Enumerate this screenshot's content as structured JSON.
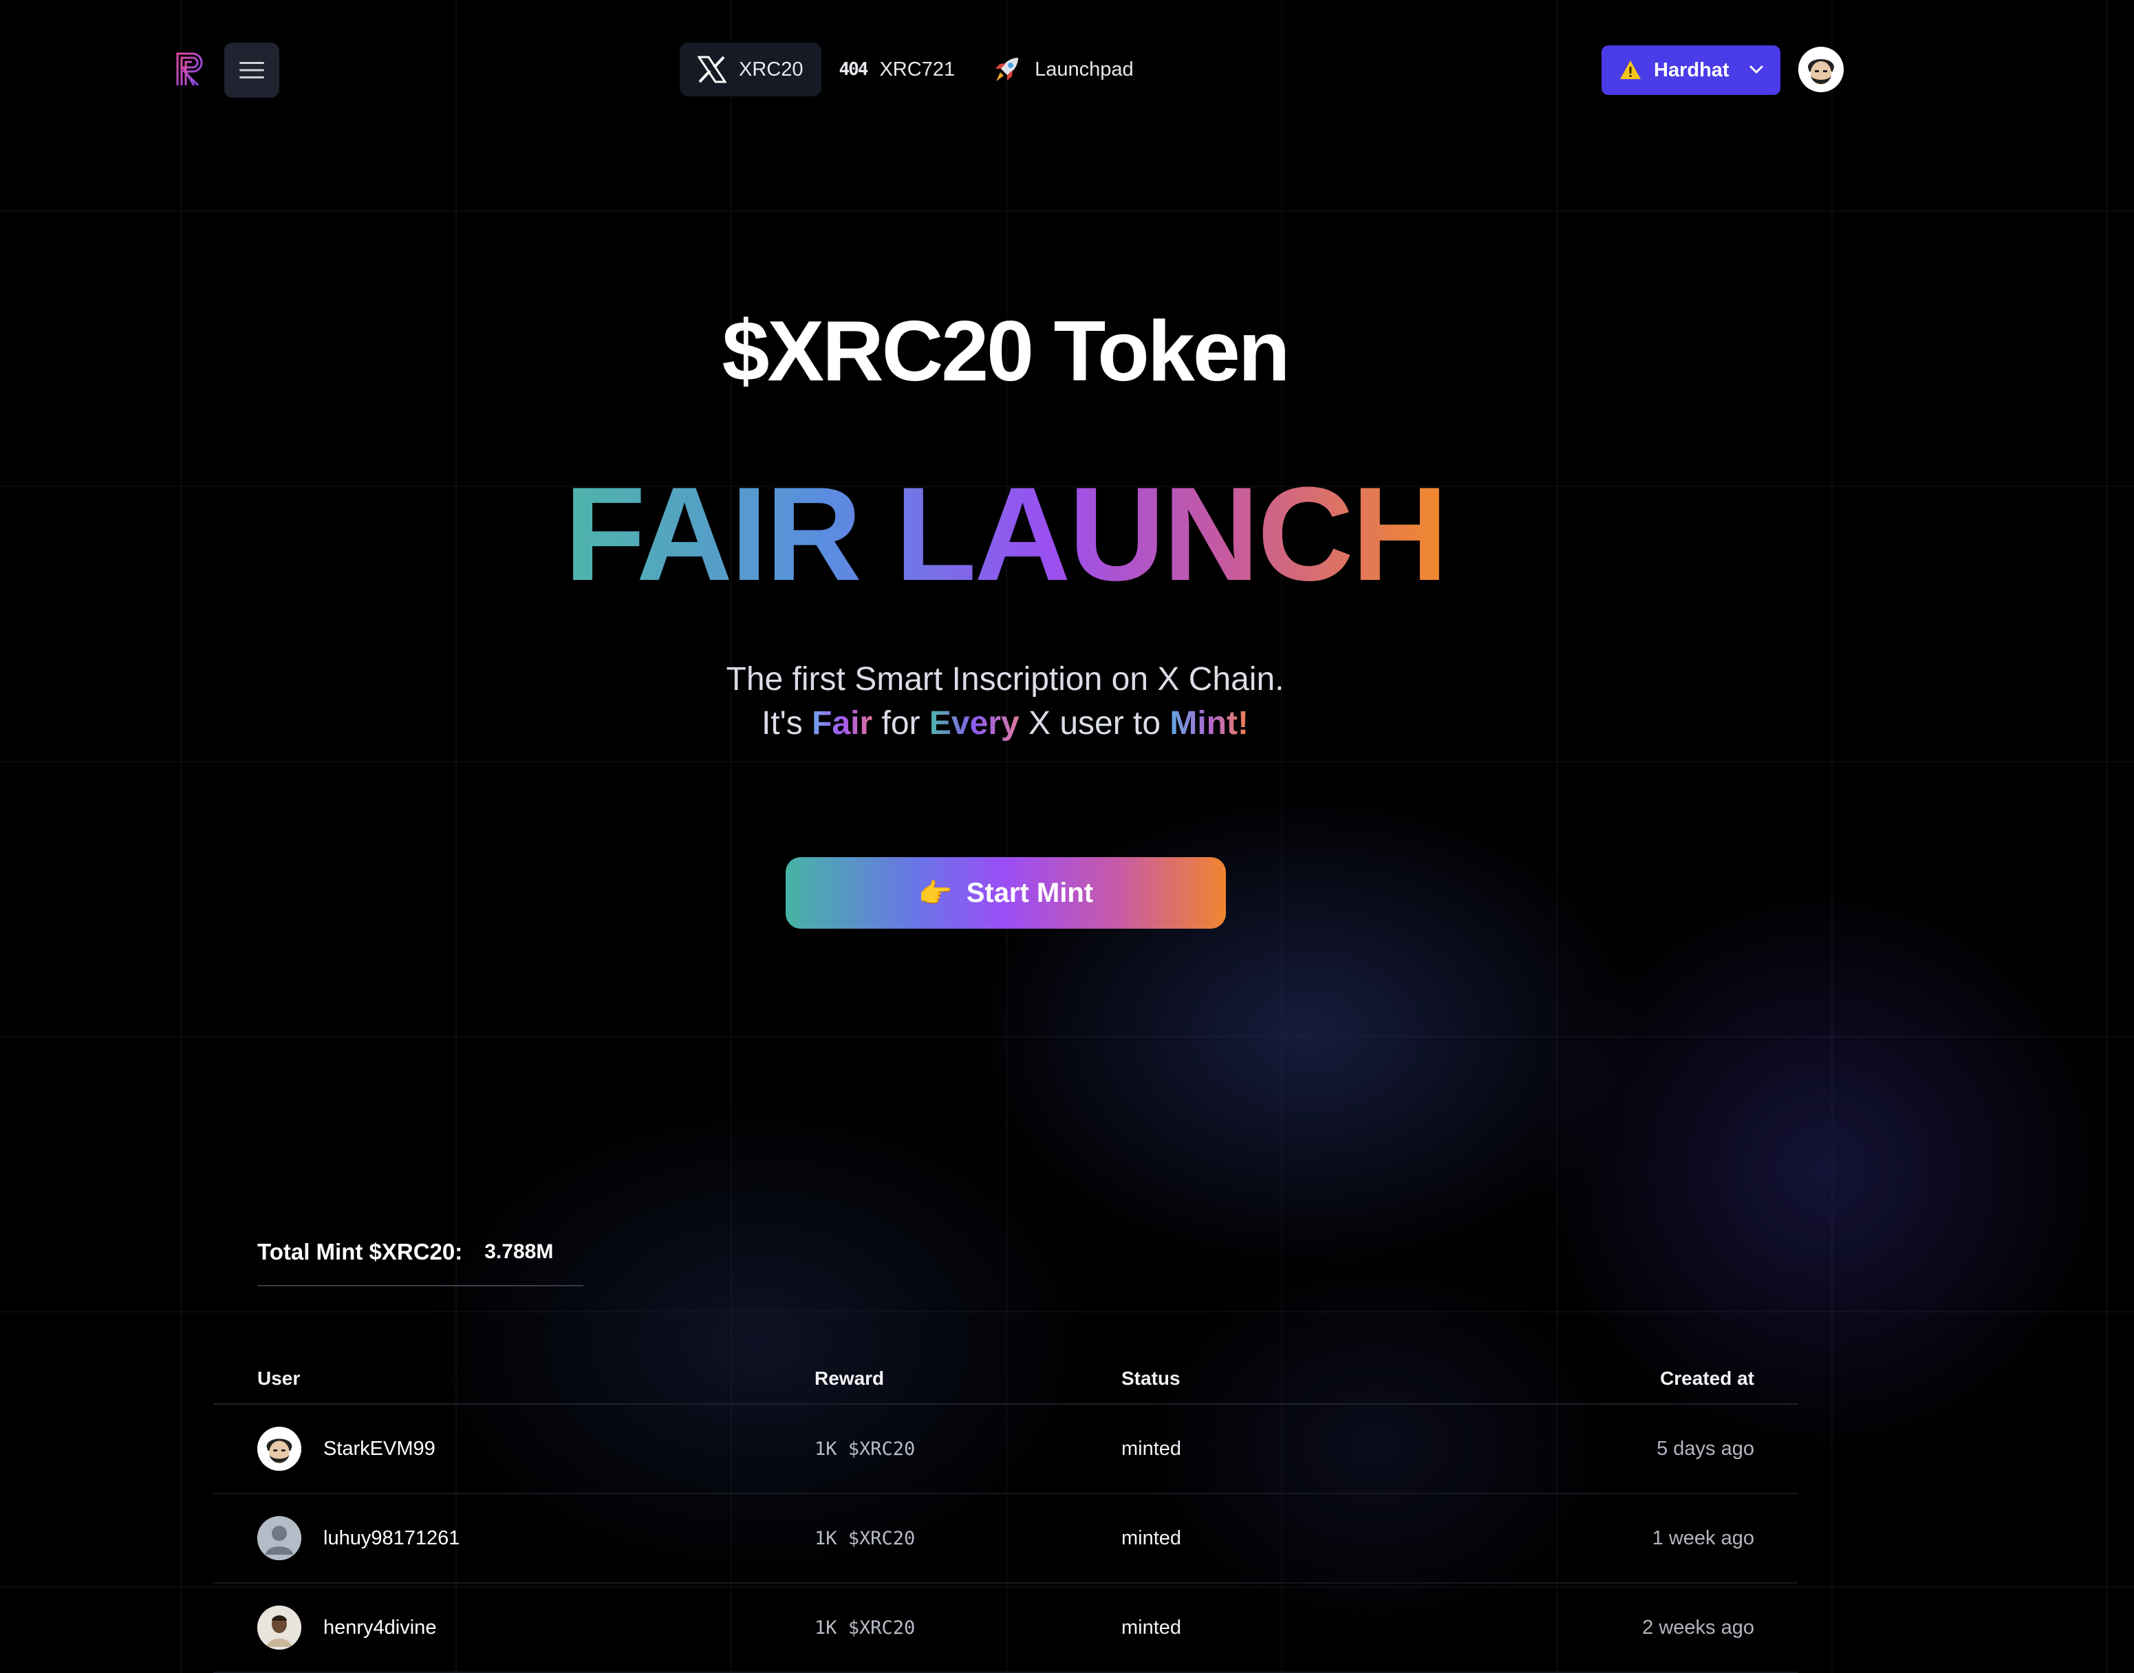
{
  "nav": {
    "tabs": [
      {
        "label": "XRC20",
        "icon": "x-logo-icon",
        "active": true
      },
      {
        "label": "XRC721",
        "icon": "404-icon",
        "active": false
      },
      {
        "label": "Launchpad",
        "icon": "rocket-icon",
        "active": false
      }
    ],
    "network": {
      "label": "Hardhat",
      "icon": "warning-icon"
    },
    "tab_404_icon_text": "404"
  },
  "hero": {
    "title": "$XRC20 Token",
    "headline": "FAIR LAUNCH",
    "subtitle_line1": "The first Smart Inscription on X Chain.",
    "line2": {
      "p1": "It's ",
      "w1": "Fair",
      "p2": " for ",
      "w2": "Every",
      "p3": " X user to ",
      "w3": "Mint!"
    },
    "cta": {
      "emoji": "👉",
      "label": "Start Mint"
    }
  },
  "stats": {
    "label": "Total Mint $XRC20:",
    "value": "3.788M"
  },
  "table": {
    "columns": {
      "user": "User",
      "reward": "Reward",
      "status": "Status",
      "created": "Created at"
    },
    "rows": [
      {
        "user": "StarkEVM99",
        "reward": "1K $XRC20",
        "status": "minted",
        "created": "5 days ago"
      },
      {
        "user": "luhuy98171261",
        "reward": "1K $XRC20",
        "status": "minted",
        "created": "1 week ago"
      },
      {
        "user": "henry4divine",
        "reward": "1K $XRC20",
        "status": "minted",
        "created": "2 weeks ago"
      }
    ]
  },
  "colors": {
    "background": "#000000",
    "accent": "#4a3ce8",
    "gradient": [
      "#4fb5a9",
      "#9b4ef5",
      "#f08530"
    ]
  }
}
